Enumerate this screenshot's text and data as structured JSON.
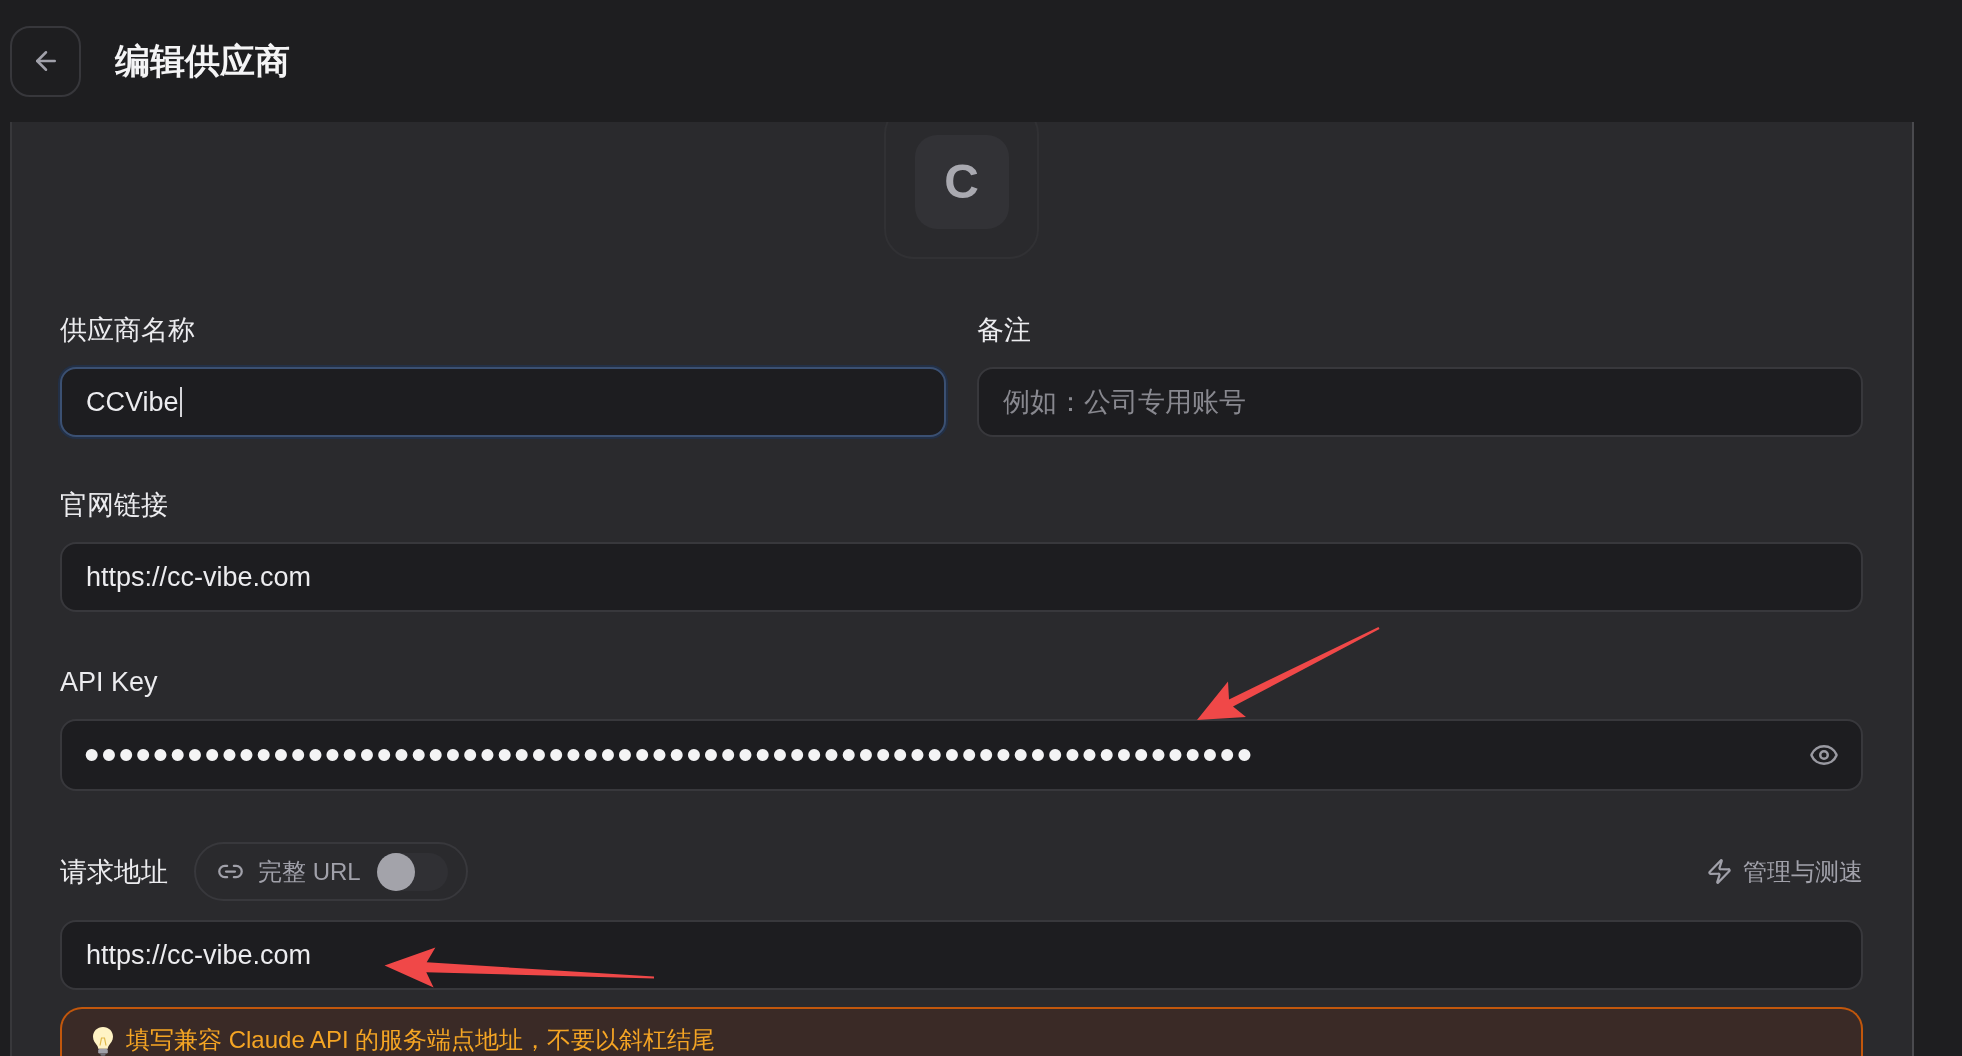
{
  "header": {
    "title": "编辑供应商"
  },
  "avatar": {
    "letter": "C"
  },
  "form": {
    "rows": [
      [
        {
          "kind": "text",
          "label": "供应商名称",
          "value": "CCVibe",
          "focused": true
        },
        {
          "kind": "text",
          "label": "备注",
          "placeholder": "例如：公司专用账号",
          "focused": false
        }
      ],
      [
        {
          "kind": "text",
          "label": "官网链接",
          "value": "https://cc-vibe.com",
          "focused": false
        }
      ],
      [
        {
          "kind": "password",
          "label": "API Key",
          "value": "••••••••••••••••••••••••••••••••••••••••••••••••••••••••••••••••••••",
          "focused": false
        }
      ]
    ]
  },
  "endpoint": {
    "label": "请求地址",
    "full_url_toggle": {
      "label": "完整 URL",
      "on": false
    },
    "action": {
      "label": "管理与测速"
    },
    "field": {
      "kind": "text",
      "value": "https://cc-vibe.com",
      "focused": false
    },
    "hint": "填写兼容 Claude API 的服务端点地址，不要以斜杠结尾"
  }
}
